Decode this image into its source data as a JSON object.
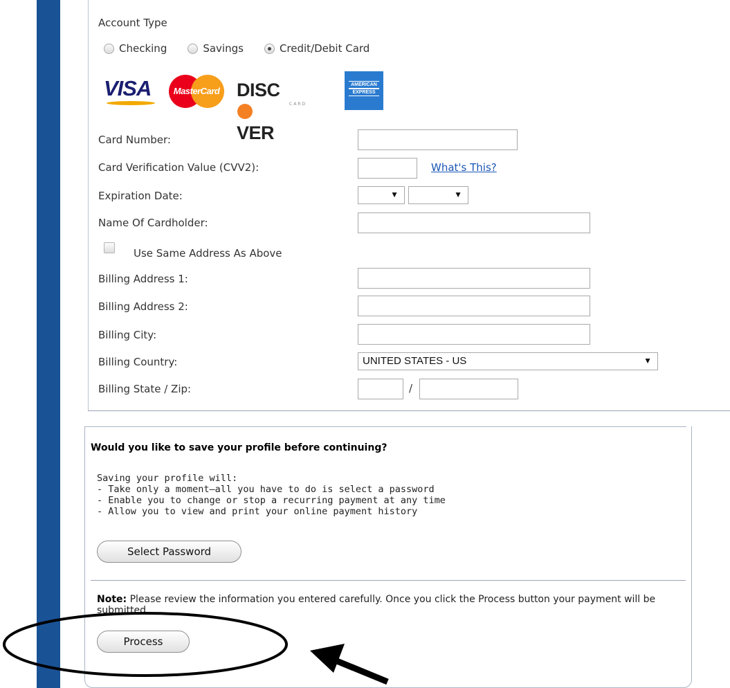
{
  "account_type": {
    "heading": "Account Type",
    "options": [
      {
        "label": "Checking",
        "selected": false
      },
      {
        "label": "Savings",
        "selected": false
      },
      {
        "label": "Credit/Debit Card",
        "selected": true
      }
    ]
  },
  "card_logos": {
    "visa": "VISA",
    "mastercard": "MasterCard",
    "discover": "DISCOVER",
    "discover_sub": "CARD",
    "amex_line1": "AMERICAN",
    "amex_line2": "EXPRESS"
  },
  "form": {
    "card_number_label": "Card Number:",
    "card_number_value": "",
    "cvv_label": "Card Verification Value (CVV2):",
    "cvv_value": "",
    "whats_this": "What's This?",
    "expiration_label": "Expiration Date:",
    "exp_month_value": "",
    "exp_year_value": "",
    "cardholder_label": "Name Of Cardholder:",
    "cardholder_value": "",
    "same_address_label": "Use Same Address As Above",
    "same_address_checked": false,
    "billing_address1_label": "Billing Address 1:",
    "billing_address1_value": "",
    "billing_address2_label": "Billing Address 2:",
    "billing_address2_value": "",
    "billing_city_label": "Billing City:",
    "billing_city_value": "",
    "billing_country_label": "Billing Country:",
    "billing_country_value": "UNITED STATES - US",
    "billing_state_zip_label": "Billing State / Zip:",
    "state_zip_separator": "/",
    "state_value": "",
    "zip_value": ""
  },
  "save_profile": {
    "question": "Would you like to save your profile before continuing?",
    "intro": "Saving your profile will:",
    "benefits": [
      "- Take only a moment—all you have to do is select a password",
      "- Enable you to change or stop a recurring payment at any time",
      "- Allow you to view and print your online payment history"
    ],
    "select_password_button": "Select Password"
  },
  "note": {
    "label": "Note:",
    "text": " Please review the information you entered carefully. Once you click the Process button your payment will be submitted."
  },
  "process_button": "Process",
  "colors": {
    "left_bar": "#1a5296",
    "link": "#1a56b5",
    "panel_border": "#a7b4c4"
  }
}
